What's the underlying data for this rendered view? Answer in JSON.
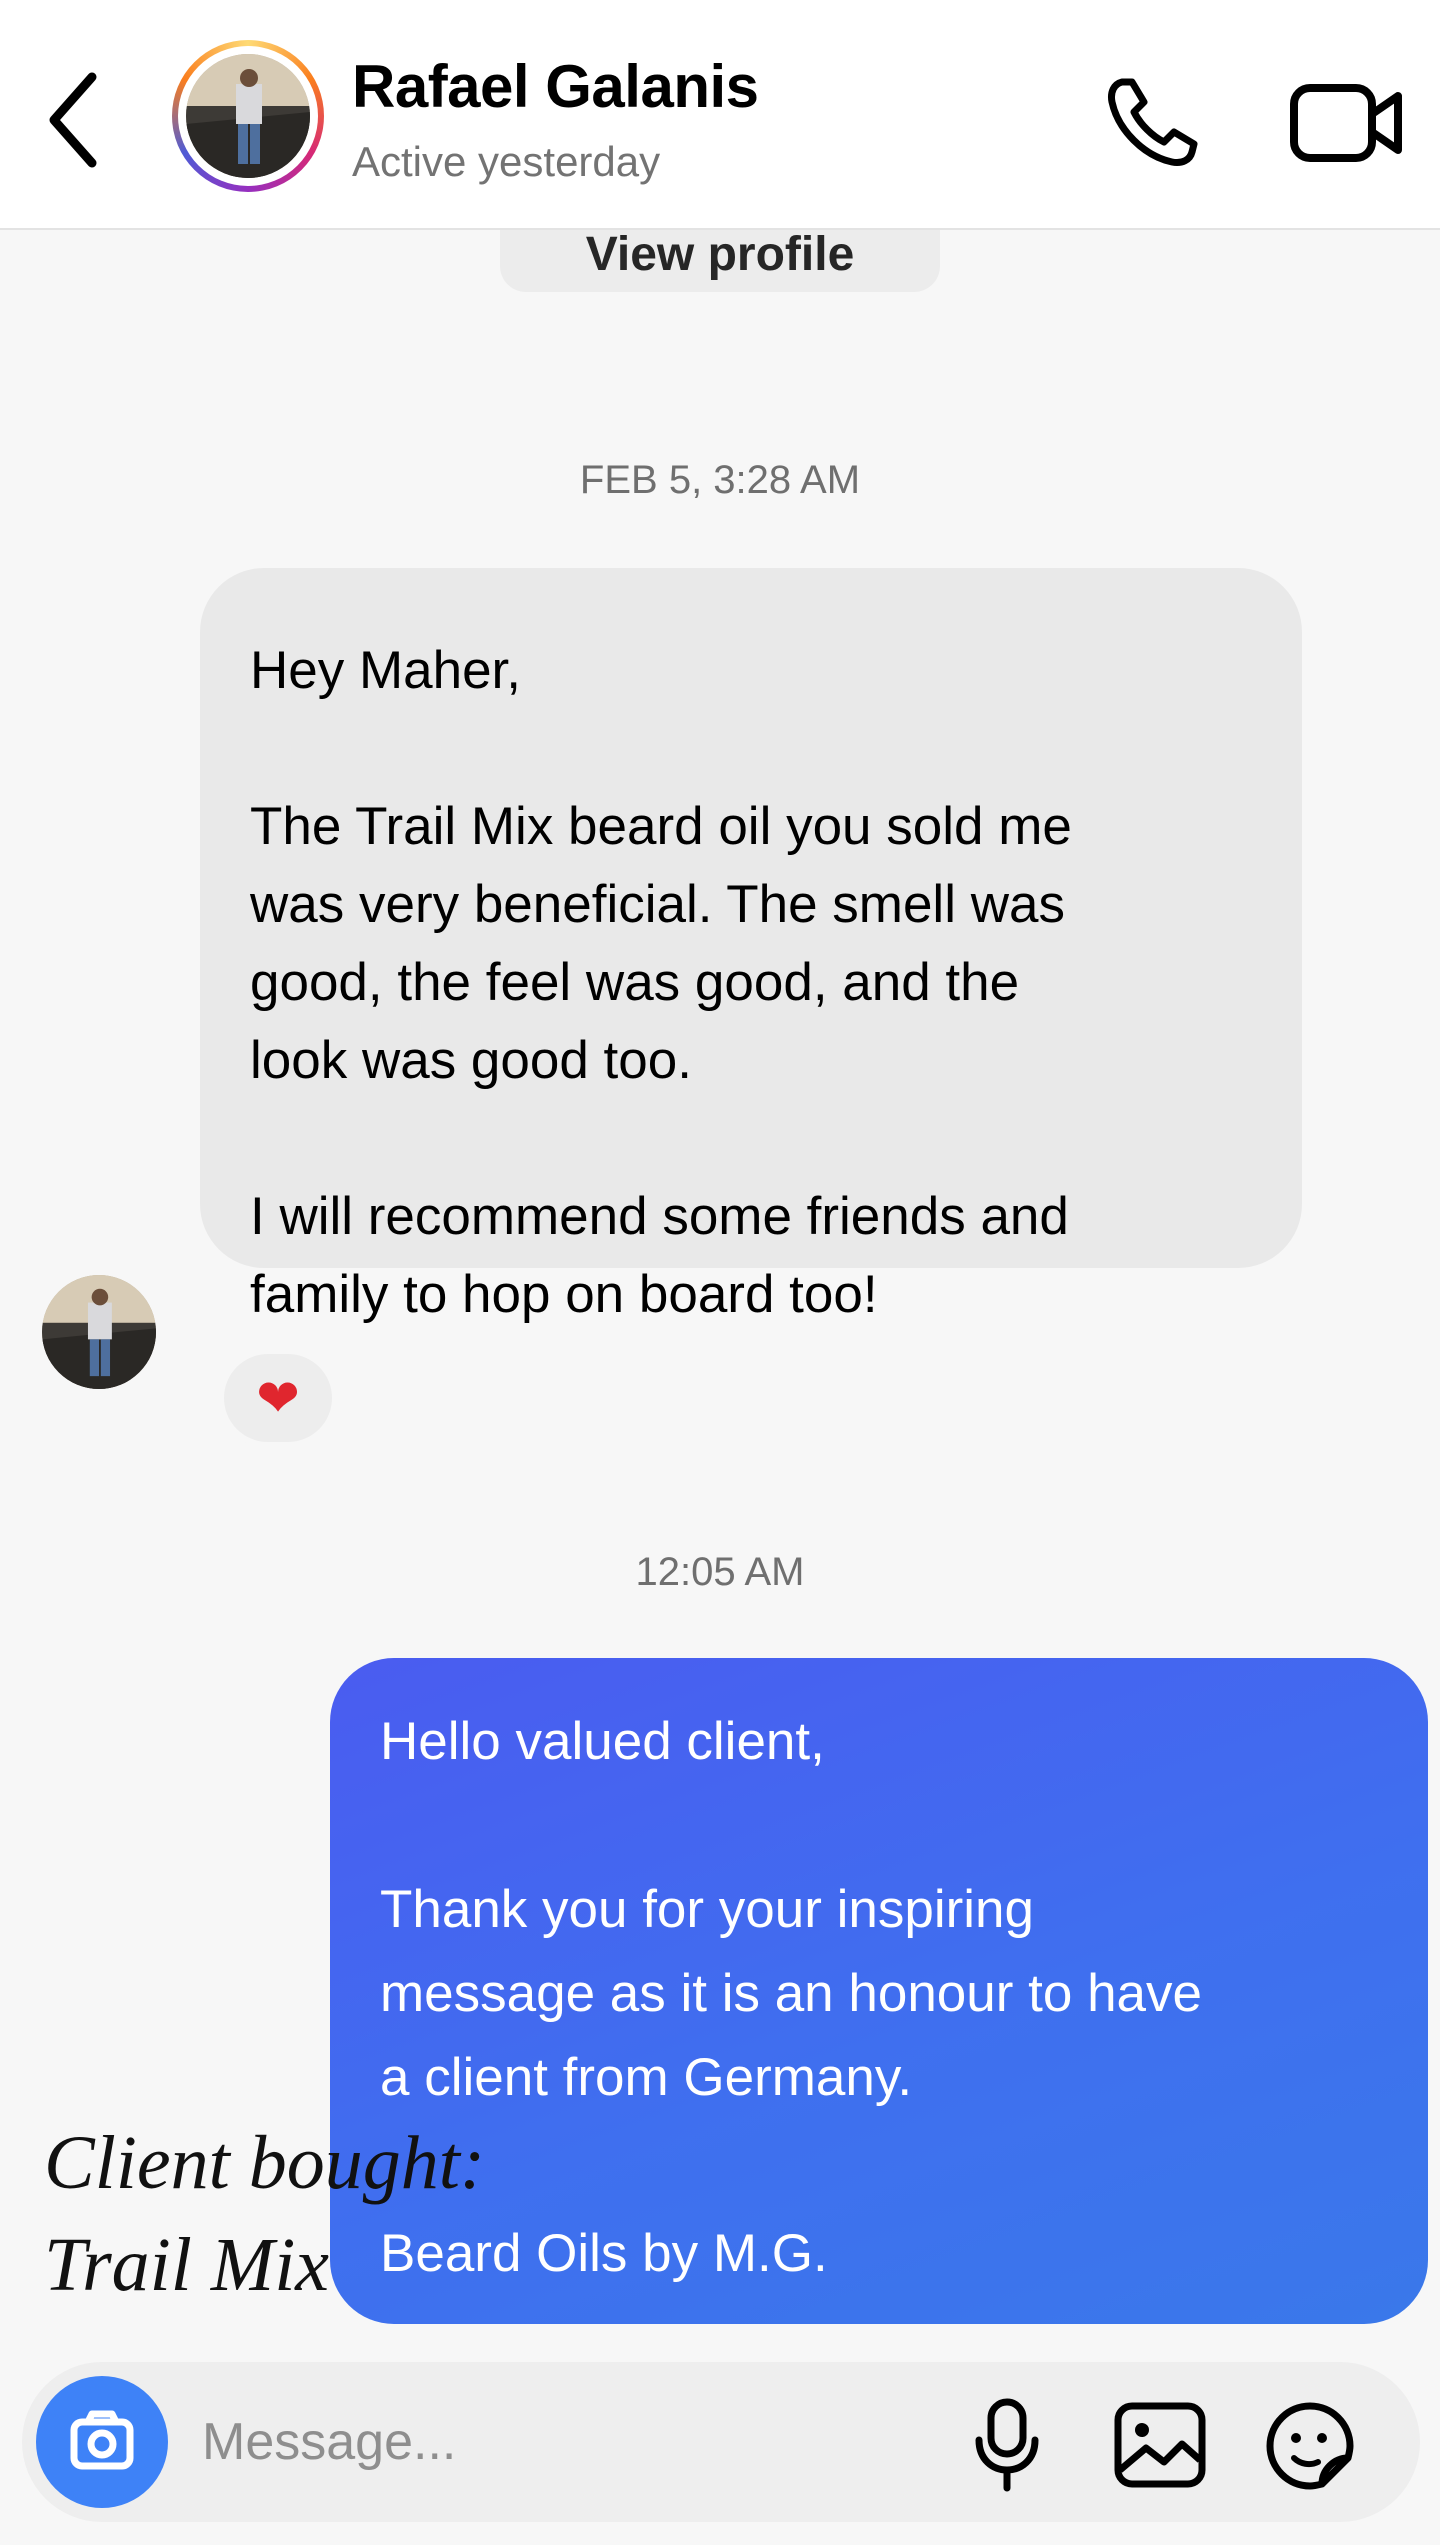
{
  "header": {
    "contact_name": "Rafael Galanis",
    "status": "Active yesterday",
    "icons": [
      "chevron-left-icon",
      "phone-icon",
      "video-camera-icon"
    ]
  },
  "thread": {
    "view_profile_label": "View profile",
    "timestamp_1": "FEB 5, 3:28 AM",
    "incoming_message": {
      "paragraphs": [
        [
          "Hey Maher,"
        ],
        [
          "The Trail Mix beard oil you sold me",
          "was very beneficial. The smell was",
          "good, the feel was good, and the",
          "look was good too."
        ],
        [
          "I will recommend some friends and",
          "family to hop on board too!"
        ]
      ],
      "reaction": "❤"
    },
    "timestamp_2": "12:05 AM",
    "outgoing_message": {
      "paragraphs": [
        [
          "Hello valued client,"
        ],
        [
          "Thank you for your inspiring",
          "message as it is an honour to have",
          "a client from Germany."
        ],
        [
          "Beard Oils by M.G."
        ]
      ]
    }
  },
  "overlay_text": {
    "line1": "Client bought:",
    "line2": "Trail Mix"
  },
  "composer": {
    "placeholder": "Message...",
    "icons": [
      "camera-icon",
      "microphone-icon",
      "gallery-icon",
      "sticker-icon"
    ]
  },
  "colors": {
    "outgoing_bubble": "#4168ee",
    "incoming_bubble": "#e9e9e9",
    "camera_button": "#3e82f7",
    "reaction_heart": "#e0262e"
  }
}
